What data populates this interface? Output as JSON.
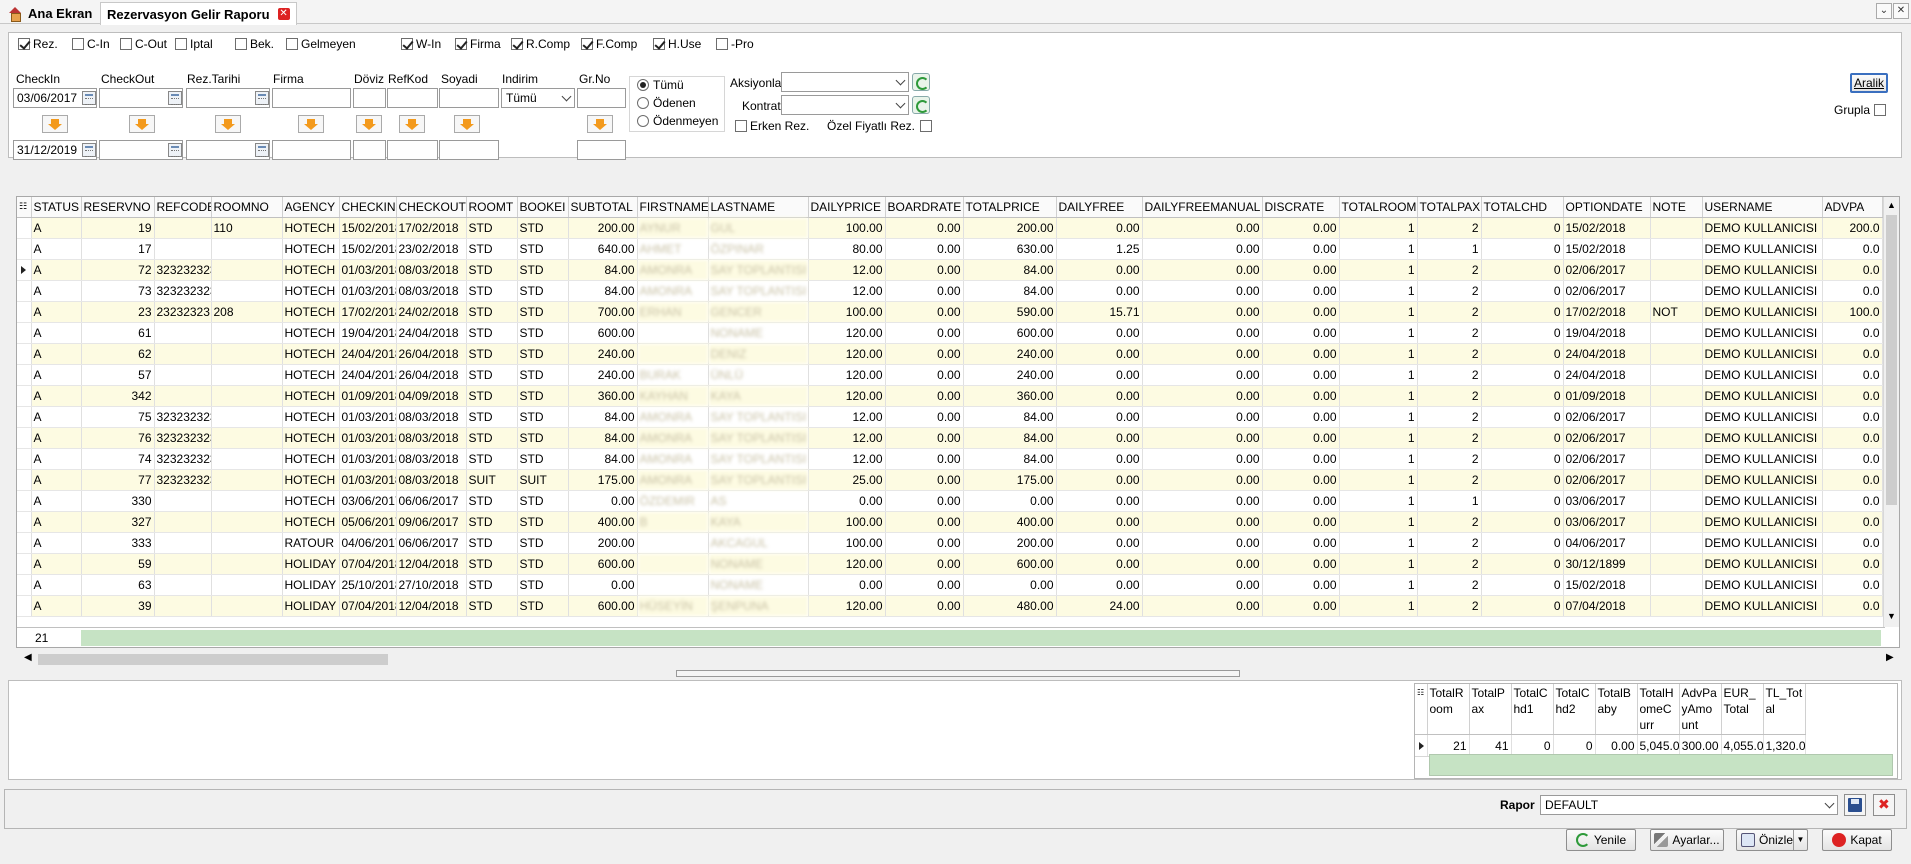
{
  "tabs": {
    "home": "Ana Ekran",
    "report": "Rezervasyon Gelir Raporu"
  },
  "filters": {
    "checkboxes": [
      {
        "label": "Rez.",
        "checked": true
      },
      {
        "label": "C-In",
        "checked": false
      },
      {
        "label": "C-Out",
        "checked": false
      },
      {
        "label": "Iptal",
        "checked": false
      },
      {
        "label": "Bek.",
        "checked": false
      },
      {
        "label": "Gelmeyen",
        "checked": false
      },
      {
        "label": "W-In",
        "checked": true
      },
      {
        "label": "Firma",
        "checked": true
      },
      {
        "label": "R.Comp",
        "checked": true
      },
      {
        "label": "F.Comp",
        "checked": true
      },
      {
        "label": "H.Use",
        "checked": true
      },
      {
        "label": "-Pro",
        "checked": false
      }
    ],
    "labels": {
      "checkin": "CheckIn",
      "checkout": "CheckOut",
      "rez_tarihi": "Rez.Tarihi",
      "firma": "Firma",
      "doviz": "Döviz",
      "refkod": "RefKod",
      "soyadi": "Soyadi",
      "indirim": "Indirim",
      "grno": "Gr.No"
    },
    "checkin_from": "03/06/2017",
    "checkin_to": "31/12/2019",
    "indirim_value": "Tümü",
    "radios": [
      {
        "label": "Tümü",
        "selected": true
      },
      {
        "label": "Ödenen",
        "selected": false
      },
      {
        "label": "Ödenmeyen",
        "selected": false
      }
    ],
    "aksiyonlar_label": "Aksiyonlar",
    "kontrat_label": "Kontrat",
    "erken_rez": "Erken Rez.",
    "ozel_fiyatli": "Özel Fiyatlı Rez.",
    "aralik": "Aralik",
    "grupla": "Grupla"
  },
  "grid": {
    "columns": [
      "STATUS",
      "RESERVNO",
      "REFCODE",
      "ROOMNO",
      "AGENCY",
      "CHECKIN",
      "CHECKOUT",
      "ROOMT",
      "BOOKEI",
      "SUBTOTAL",
      "FIRSTNAME",
      "LASTNAME",
      "DAILYPRICE",
      "BOARDRATE",
      "TOTALPRICE",
      "DAILYFREE",
      "DAILYFREEMANUAL",
      "DISCRATE",
      "TOTALROOM",
      "TOTALPAX",
      "TOTALCHD",
      "OPTIONDATE",
      "NOTE",
      "USERNAME",
      "ADVPA"
    ],
    "rows": [
      [
        "A",
        "19",
        "",
        "110",
        "HOTECH",
        "15/02/2018",
        "17/02/2018",
        "STD",
        "STD",
        "200.00",
        "AYNUR",
        "GUL",
        "100.00",
        "0.00",
        "200.00",
        "0.00",
        "0.00",
        "0.00",
        "1",
        "2",
        "0",
        "15/02/2018",
        "",
        "DEMO KULLANICISI",
        "200.0"
      ],
      [
        "A",
        "17",
        "",
        "",
        "HOTECH",
        "15/02/2018",
        "23/02/2018",
        "STD",
        "STD",
        "640.00",
        "AHMET",
        "ÖZPINAR",
        "80.00",
        "0.00",
        "630.00",
        "1.25",
        "0.00",
        "0.00",
        "1",
        "1",
        "0",
        "15/02/2018",
        "",
        "DEMO KULLANICISI",
        "0.0"
      ],
      [
        "A",
        "72",
        "323232323",
        "",
        "HOTECH",
        "01/03/2018",
        "08/03/2018",
        "STD",
        "STD",
        "84.00",
        "AMONRA",
        "SAY TOPLANTISI",
        "12.00",
        "0.00",
        "84.00",
        "0.00",
        "0.00",
        "0.00",
        "1",
        "2",
        "0",
        "02/06/2017",
        "",
        "DEMO KULLANICISI",
        "0.0"
      ],
      [
        "A",
        "73",
        "323232323",
        "",
        "HOTECH",
        "01/03/2018",
        "08/03/2018",
        "STD",
        "STD",
        "84.00",
        "AMONRA",
        "SAY TOPLANTISI",
        "12.00",
        "0.00",
        "84.00",
        "0.00",
        "0.00",
        "0.00",
        "1",
        "2",
        "0",
        "02/06/2017",
        "",
        "DEMO KULLANICISI",
        "0.0"
      ],
      [
        "A",
        "23",
        "23232323",
        "208",
        "HOTECH",
        "17/02/2018",
        "24/02/2018",
        "STD",
        "STD",
        "700.00",
        "ERHAN",
        "GENCER",
        "100.00",
        "0.00",
        "590.00",
        "15.71",
        "0.00",
        "0.00",
        "1",
        "2",
        "0",
        "17/02/2018",
        "NOT",
        "DEMO KULLANICISI",
        "100.0"
      ],
      [
        "A",
        "61",
        "",
        "",
        "HOTECH",
        "19/04/2018",
        "24/04/2018",
        "STD",
        "STD",
        "600.00",
        "",
        "NONAME",
        "120.00",
        "0.00",
        "600.00",
        "0.00",
        "0.00",
        "0.00",
        "1",
        "2",
        "0",
        "19/04/2018",
        "",
        "DEMO KULLANICISI",
        "0.0"
      ],
      [
        "A",
        "62",
        "",
        "",
        "HOTECH",
        "24/04/2018",
        "26/04/2018",
        "STD",
        "STD",
        "240.00",
        "",
        "DENIZ",
        "120.00",
        "0.00",
        "240.00",
        "0.00",
        "0.00",
        "0.00",
        "1",
        "2",
        "0",
        "24/04/2018",
        "",
        "DEMO KULLANICISI",
        "0.0"
      ],
      [
        "A",
        "57",
        "",
        "",
        "HOTECH",
        "24/04/2018",
        "26/04/2018",
        "STD",
        "STD",
        "240.00",
        "BURAK",
        "ÜNLÜ",
        "120.00",
        "0.00",
        "240.00",
        "0.00",
        "0.00",
        "0.00",
        "1",
        "2",
        "0",
        "24/04/2018",
        "",
        "DEMO KULLANICISI",
        "0.0"
      ],
      [
        "A",
        "342",
        "",
        "",
        "HOTECH",
        "01/09/2018",
        "04/09/2018",
        "STD",
        "STD",
        "360.00",
        "KAYHAN",
        "KAYA",
        "120.00",
        "0.00",
        "360.00",
        "0.00",
        "0.00",
        "0.00",
        "1",
        "2",
        "0",
        "01/09/2018",
        "",
        "DEMO KULLANICISI",
        "0.0"
      ],
      [
        "A",
        "75",
        "323232323",
        "",
        "HOTECH",
        "01/03/2018",
        "08/03/2018",
        "STD",
        "STD",
        "84.00",
        "AMONRA",
        "SAY TOPLANTISI",
        "12.00",
        "0.00",
        "84.00",
        "0.00",
        "0.00",
        "0.00",
        "1",
        "2",
        "0",
        "02/06/2017",
        "",
        "DEMO KULLANICISI",
        "0.0"
      ],
      [
        "A",
        "76",
        "323232323",
        "",
        "HOTECH",
        "01/03/2018",
        "08/03/2018",
        "STD",
        "STD",
        "84.00",
        "AMONRA",
        "SAY TOPLANTISI",
        "12.00",
        "0.00",
        "84.00",
        "0.00",
        "0.00",
        "0.00",
        "1",
        "2",
        "0",
        "02/06/2017",
        "",
        "DEMO KULLANICISI",
        "0.0"
      ],
      [
        "A",
        "74",
        "323232323",
        "",
        "HOTECH",
        "01/03/2018",
        "08/03/2018",
        "STD",
        "STD",
        "84.00",
        "AMONRA",
        "SAY TOPLANTISI",
        "12.00",
        "0.00",
        "84.00",
        "0.00",
        "0.00",
        "0.00",
        "1",
        "2",
        "0",
        "02/06/2017",
        "",
        "DEMO KULLANICISI",
        "0.0"
      ],
      [
        "A",
        "77",
        "323232323",
        "",
        "HOTECH",
        "01/03/2018",
        "08/03/2018",
        "SUIT",
        "SUIT",
        "175.00",
        "AMONRA",
        "SAY TOPLANTISI",
        "25.00",
        "0.00",
        "175.00",
        "0.00",
        "0.00",
        "0.00",
        "1",
        "2",
        "0",
        "02/06/2017",
        "",
        "DEMO KULLANICISI",
        "0.0"
      ],
      [
        "A",
        "330",
        "",
        "",
        "HOTECH",
        "03/06/2017",
        "06/06/2017",
        "STD",
        "STD",
        "0.00",
        "ÖZDEMIR",
        "AS",
        "0.00",
        "0.00",
        "0.00",
        "0.00",
        "0.00",
        "0.00",
        "1",
        "1",
        "0",
        "03/06/2017",
        "",
        "DEMO KULLANICISI",
        "0.0"
      ],
      [
        "A",
        "327",
        "",
        "",
        "HOTECH",
        "05/06/2017",
        "09/06/2017",
        "STD",
        "STD",
        "400.00",
        "B",
        "KAYA",
        "100.00",
        "0.00",
        "400.00",
        "0.00",
        "0.00",
        "0.00",
        "1",
        "2",
        "0",
        "03/06/2017",
        "",
        "DEMO KULLANICISI",
        "0.0"
      ],
      [
        "A",
        "333",
        "",
        "",
        "RATOUR",
        "04/06/2017",
        "06/06/2017",
        "STD",
        "STD",
        "200.00",
        "",
        "AKCAGUL",
        "100.00",
        "0.00",
        "200.00",
        "0.00",
        "0.00",
        "0.00",
        "1",
        "2",
        "0",
        "04/06/2017",
        "",
        "DEMO KULLANICISI",
        "0.0"
      ],
      [
        "A",
        "59",
        "",
        "",
        "HOLIDAY",
        "07/04/2018",
        "12/04/2018",
        "STD",
        "STD",
        "600.00",
        "",
        "NONAME",
        "120.00",
        "0.00",
        "600.00",
        "0.00",
        "0.00",
        "0.00",
        "1",
        "2",
        "0",
        "30/12/1899",
        "",
        "DEMO KULLANICISI",
        "0.0"
      ],
      [
        "A",
        "63",
        "",
        "",
        "HOLIDAY",
        "25/10/2018",
        "27/10/2018",
        "STD",
        "STD",
        "0.00",
        "",
        "NONAME",
        "0.00",
        "0.00",
        "0.00",
        "0.00",
        "0.00",
        "0.00",
        "1",
        "2",
        "0",
        "15/02/2018",
        "",
        "DEMO KULLANICISI",
        "0.0"
      ],
      [
        "A",
        "39",
        "",
        "",
        "HOLIDAY",
        "07/04/2018",
        "12/04/2018",
        "STD",
        "STD",
        "600.00",
        "HÜSEYİN",
        "ŞENPUNA",
        "120.00",
        "0.00",
        "480.00",
        "24.00",
        "0.00",
        "0.00",
        "1",
        "2",
        "0",
        "07/04/2018",
        "",
        "DEMO KULLANICISI",
        "0.0"
      ]
    ],
    "record_count": "21"
  },
  "summary": {
    "columns": [
      "TotalRoom",
      "TotalPax",
      "TotalChd1",
      "TotalChd2",
      "TotalBaby",
      "TotalHomeCurr",
      "AdvPayAmount",
      "EUR_Total",
      "TL_Total"
    ],
    "values": [
      "21",
      "41",
      "0",
      "0",
      "0.00",
      "5,045.00",
      "300.00",
      "4,055.00",
      "1,320.00"
    ]
  },
  "status": {
    "rapor_label": "Rapor",
    "rapor_value": "DEFAULT",
    "yenile": "Yenile",
    "ayarlar": "Ayarlar...",
    "onizle": "Önizle",
    "kapat": "Kapat"
  }
}
